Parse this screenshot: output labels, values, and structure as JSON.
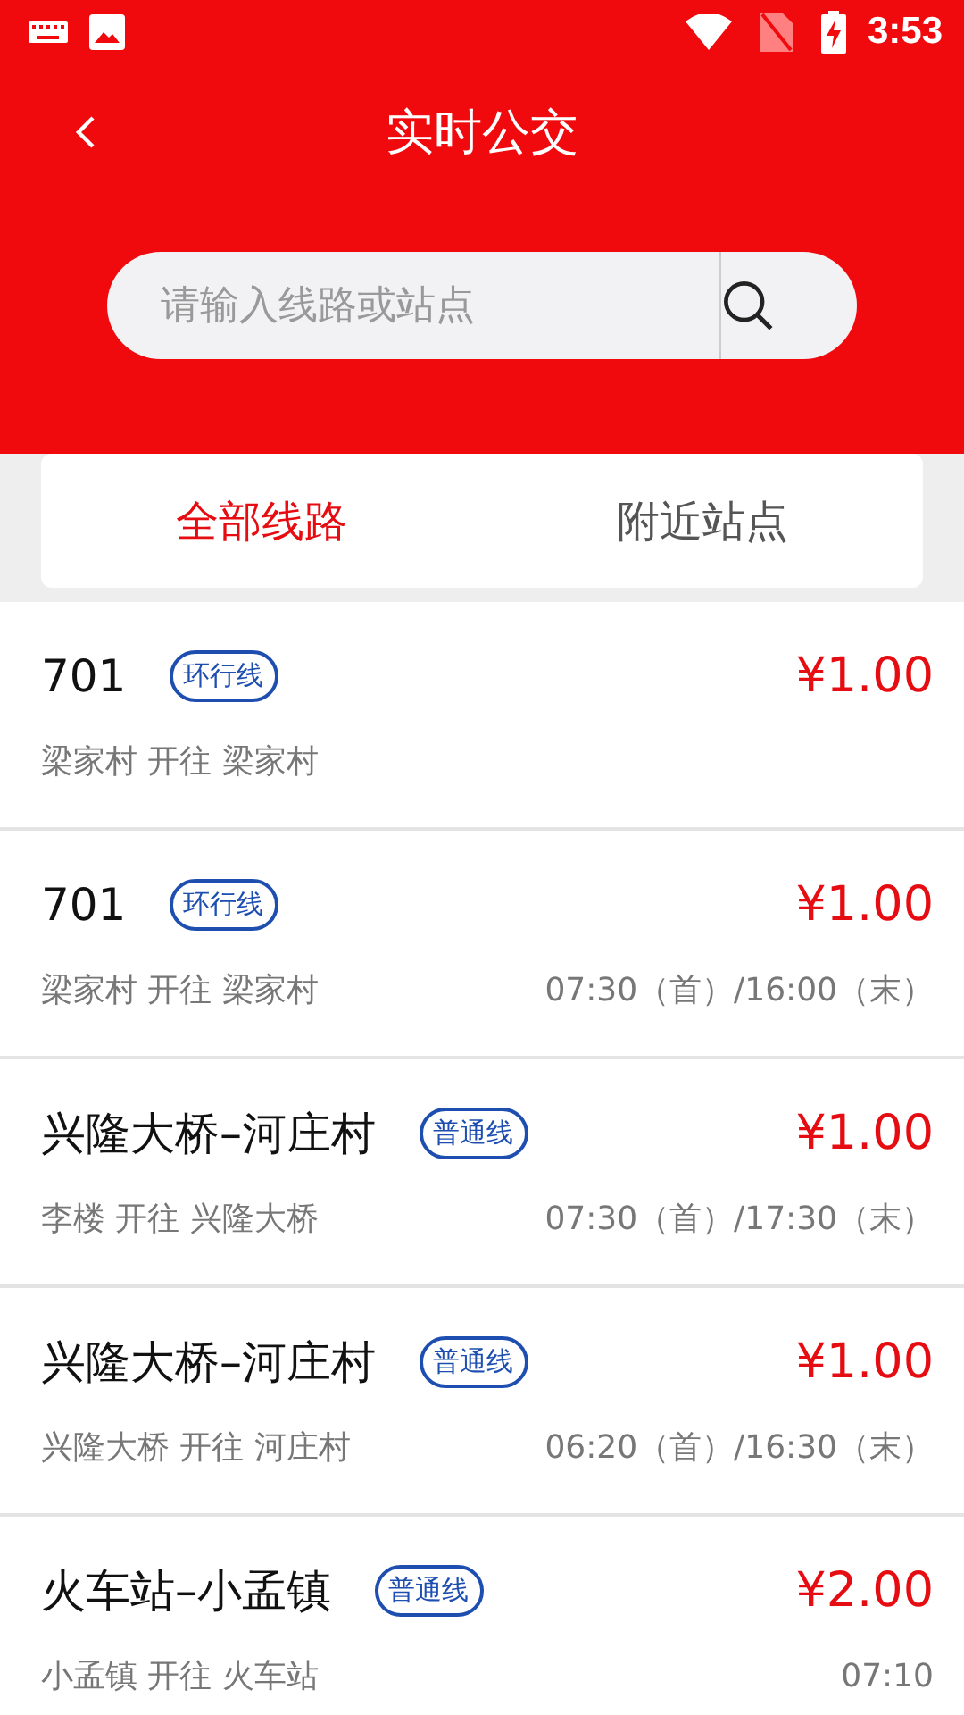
{
  "status_bar": {
    "time": "3:53"
  },
  "header": {
    "title": "实时公交"
  },
  "search": {
    "placeholder": "请输入线路或站点"
  },
  "tabs": [
    {
      "label": "全部线路",
      "selected": true
    },
    {
      "label": "附近站点",
      "selected": false
    }
  ],
  "routes": [
    {
      "name": "701",
      "tag": "环行线",
      "price": "¥1.00",
      "direction": "梁家村 开往 梁家村"
    },
    {
      "name": "701",
      "tag": "环行线",
      "price": "¥1.00",
      "direction": "梁家村 开往 梁家村",
      "hours": "07:30（首）/16:00（末）"
    },
    {
      "name": "兴隆大桥–河庄村",
      "tag": "普通线",
      "price": "¥1.00",
      "direction": "李楼 开往 兴隆大桥",
      "hours": "07:30（首）/17:30（末）"
    },
    {
      "name": "兴隆大桥–河庄村",
      "tag": "普通线",
      "price": "¥1.00",
      "direction": "兴隆大桥 开往 河庄村",
      "hours": "06:20（首）/16:30（末）"
    },
    {
      "name": "火车站–小孟镇",
      "tag": "普通线",
      "price": "¥2.00",
      "direction": "小孟镇 开往 火车站",
      "hours": "07:10"
    }
  ]
}
